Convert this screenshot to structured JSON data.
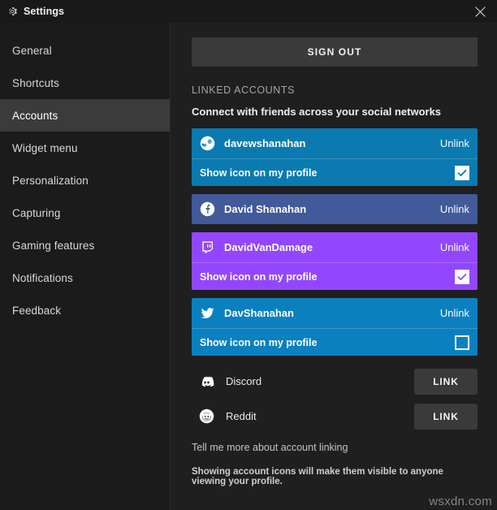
{
  "window": {
    "title": "Settings",
    "gear_icon": "gear-icon",
    "close_icon": "close-icon"
  },
  "sidebar": {
    "items": [
      {
        "label": "General",
        "active": false
      },
      {
        "label": "Shortcuts",
        "active": false
      },
      {
        "label": "Accounts",
        "active": true
      },
      {
        "label": "Widget menu",
        "active": false
      },
      {
        "label": "Personalization",
        "active": false
      },
      {
        "label": "Capturing",
        "active": false
      },
      {
        "label": "Gaming features",
        "active": false
      },
      {
        "label": "Notifications",
        "active": false
      },
      {
        "label": "Feedback",
        "active": false
      }
    ]
  },
  "content": {
    "sign_out_label": "SIGN OUT",
    "section_label": "LINKED ACCOUNTS",
    "section_subtitle": "Connect with friends across your social networks",
    "show_icon_label": "Show icon on my profile",
    "unlink_label": "Unlink",
    "link_label": "LINK",
    "more_link": "Tell me more about account linking",
    "footnote": "Showing account icons will make them visible to anyone viewing your profile."
  },
  "accounts": [
    {
      "service": "steam",
      "icon": "steam-icon",
      "username": "davewshanahan",
      "color": "#0b7ab0",
      "has_toggle": true,
      "checked": true,
      "check_color": "#0b7ab0"
    },
    {
      "service": "facebook",
      "icon": "facebook-icon",
      "username": "David Shanahan",
      "color": "#42599a",
      "has_toggle": false,
      "checked": false,
      "check_color": "#42599a"
    },
    {
      "service": "twitch",
      "icon": "twitch-icon",
      "username": "DavidVanDamage",
      "color": "#9247ff",
      "has_toggle": true,
      "checked": true,
      "check_color": "#9247ff"
    },
    {
      "service": "twitter",
      "icon": "twitter-icon",
      "username": "DavShanahan",
      "color": "#0b80bf",
      "has_toggle": true,
      "checked": false,
      "check_color": "#0b80bf"
    }
  ],
  "unlinked_services": [
    {
      "name": "Discord",
      "icon": "discord-icon"
    },
    {
      "name": "Reddit",
      "icon": "reddit-icon"
    }
  ],
  "watermark": "wsxdn.com",
  "theme": {
    "window_bg": "#1b1b1b",
    "content_bg": "#1f1f1f",
    "active_nav_bg": "#3b3b3b",
    "button_bg": "#3a3a3a"
  }
}
